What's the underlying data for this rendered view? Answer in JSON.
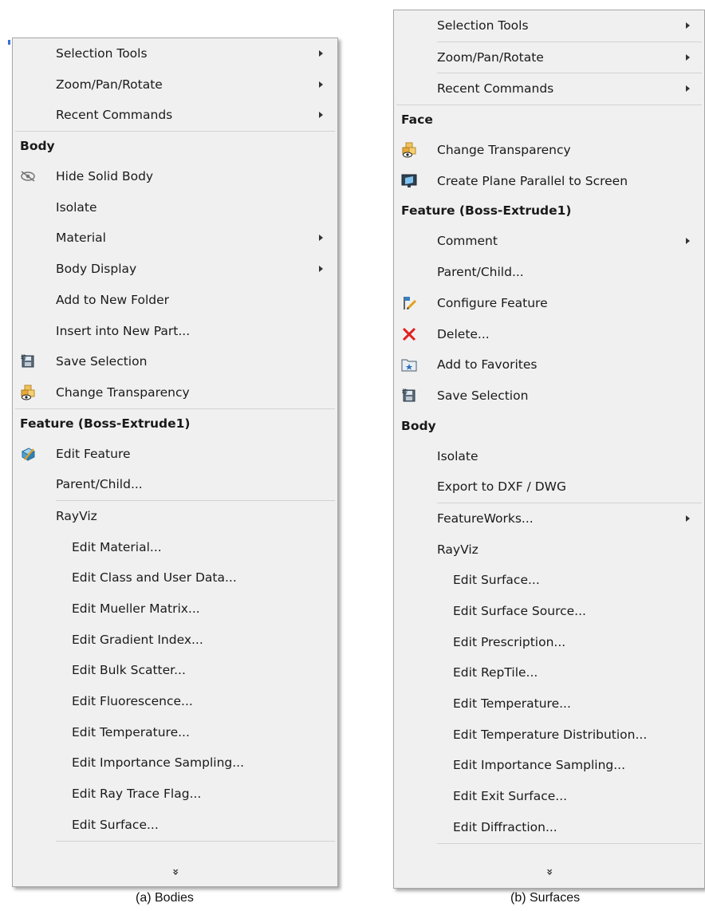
{
  "bodies_menu": {
    "top_items": [
      "Selection Tools",
      "Zoom/Pan/Rotate",
      "Recent Commands"
    ],
    "body_header": "Body",
    "body_items": [
      {
        "label": "Hide Solid Body",
        "icon": "hide-eye-icon"
      },
      {
        "label": "Isolate"
      },
      {
        "label": "Material",
        "submenu": true
      },
      {
        "label": "Body Display",
        "submenu": true
      },
      {
        "label": "Add to New Folder"
      },
      {
        "label": "Insert into New Part..."
      },
      {
        "label": "Save Selection",
        "icon": "save-selection-icon"
      },
      {
        "label": "Change Transparency",
        "icon": "transparency-icon"
      }
    ],
    "feature_header": "Feature (Boss-Extrude1)",
    "feature_items": [
      {
        "label": "Edit Feature",
        "icon": "edit-feature-icon"
      },
      {
        "label": "Parent/Child..."
      }
    ],
    "rayviz_label": "RayViz",
    "rayviz_items": [
      "Edit Material...",
      "Edit Class and User Data...",
      "Edit Mueller Matrix...",
      "Edit Gradient Index...",
      "Edit Bulk Scatter...",
      "Edit Fluorescence...",
      "Edit Temperature...",
      "Edit Importance Sampling...",
      "Edit Ray Trace Flag...",
      "Edit Surface..."
    ],
    "more_glyph": "»",
    "caption": "(a) Bodies"
  },
  "surfaces_menu": {
    "top_items": [
      "Selection Tools",
      "Zoom/Pan/Rotate",
      "Recent Commands"
    ],
    "face_header": "Face",
    "face_items": [
      {
        "label": "Change Transparency",
        "icon": "transparency-icon"
      },
      {
        "label": "Create Plane Parallel to Screen",
        "icon": "plane-screen-icon"
      }
    ],
    "feature_header": "Feature (Boss-Extrude1)",
    "feature_items": [
      {
        "label": "Comment",
        "submenu": true
      },
      {
        "label": "Parent/Child..."
      },
      {
        "label": "Configure Feature",
        "icon": "configure-feature-icon"
      },
      {
        "label": "Delete...",
        "icon": "delete-x-icon"
      },
      {
        "label": "Add to Favorites",
        "icon": "favorites-folder-icon"
      },
      {
        "label": "Save Selection",
        "icon": "save-selection-icon"
      }
    ],
    "body_header": "Body",
    "body_items": [
      {
        "label": "Isolate"
      },
      {
        "label": "Export to DXF / DWG"
      },
      {
        "label": "FeatureWorks...",
        "submenu": true
      }
    ],
    "rayviz_label": "RayViz",
    "rayviz_items": [
      "Edit Surface...",
      "Edit Surface Source...",
      "Edit Prescription...",
      "Edit RepTile...",
      "Edit Temperature...",
      "Edit Temperature Distribution...",
      "Edit Importance Sampling...",
      "Edit Exit Surface...",
      "Edit Diffraction..."
    ],
    "more_glyph": "»",
    "caption": "(b) Surfaces"
  }
}
